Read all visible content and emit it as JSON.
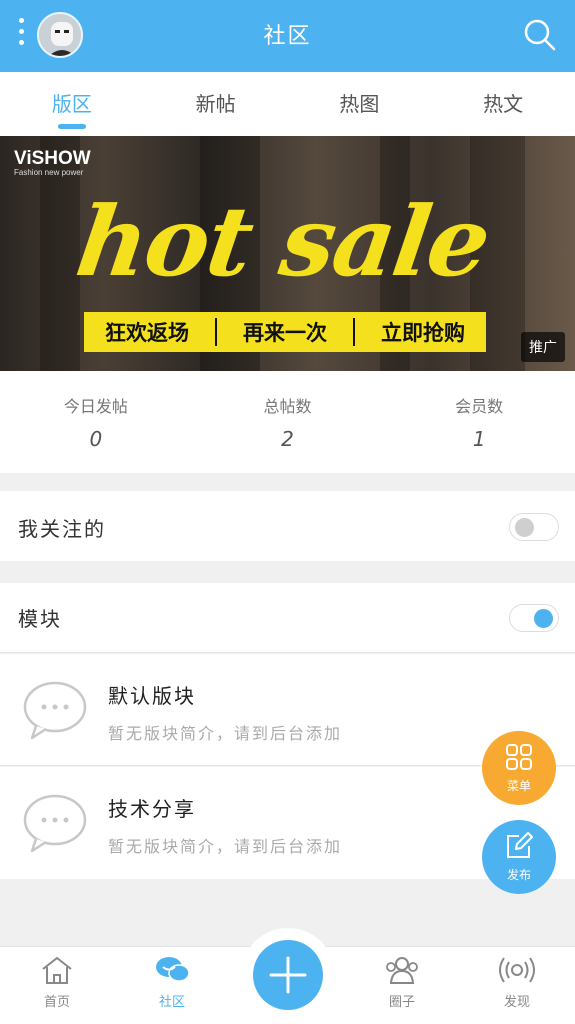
{
  "header": {
    "title": "社区"
  },
  "tabs": [
    {
      "label": "版区",
      "active": true
    },
    {
      "label": "新帖",
      "active": false
    },
    {
      "label": "热图",
      "active": false
    },
    {
      "label": "热文",
      "active": false
    }
  ],
  "banner": {
    "logo": "ViSHOW",
    "logo_sub": "Fashion new power",
    "headline": "hot sale",
    "slogans": [
      "狂欢返场",
      "再来一次",
      "立即抢购"
    ],
    "tag": "推广"
  },
  "stats": [
    {
      "label": "今日发帖",
      "value": "0"
    },
    {
      "label": "总帖数",
      "value": "2"
    },
    {
      "label": "会员数",
      "value": "1"
    }
  ],
  "following": {
    "label": "我关注的",
    "toggle": "off"
  },
  "modules": {
    "label": "模块",
    "toggle": "on"
  },
  "forums": [
    {
      "name": "默认版块",
      "desc": "暂无版块简介，请到后台添加"
    },
    {
      "name": "技术分享",
      "desc": "暂无版块简介，请到后台添加"
    }
  ],
  "fab": {
    "menu_label": "菜单",
    "post_label": "发布"
  },
  "bottom_nav": [
    {
      "label": "首页",
      "active": false
    },
    {
      "label": "社区",
      "active": true
    },
    {
      "label": "圈子",
      "active": false
    },
    {
      "label": "发现",
      "active": false
    }
  ],
  "colors": {
    "accent": "#4db3f0",
    "orange": "#f8a932",
    "banner_yellow": "#f4e01c"
  }
}
